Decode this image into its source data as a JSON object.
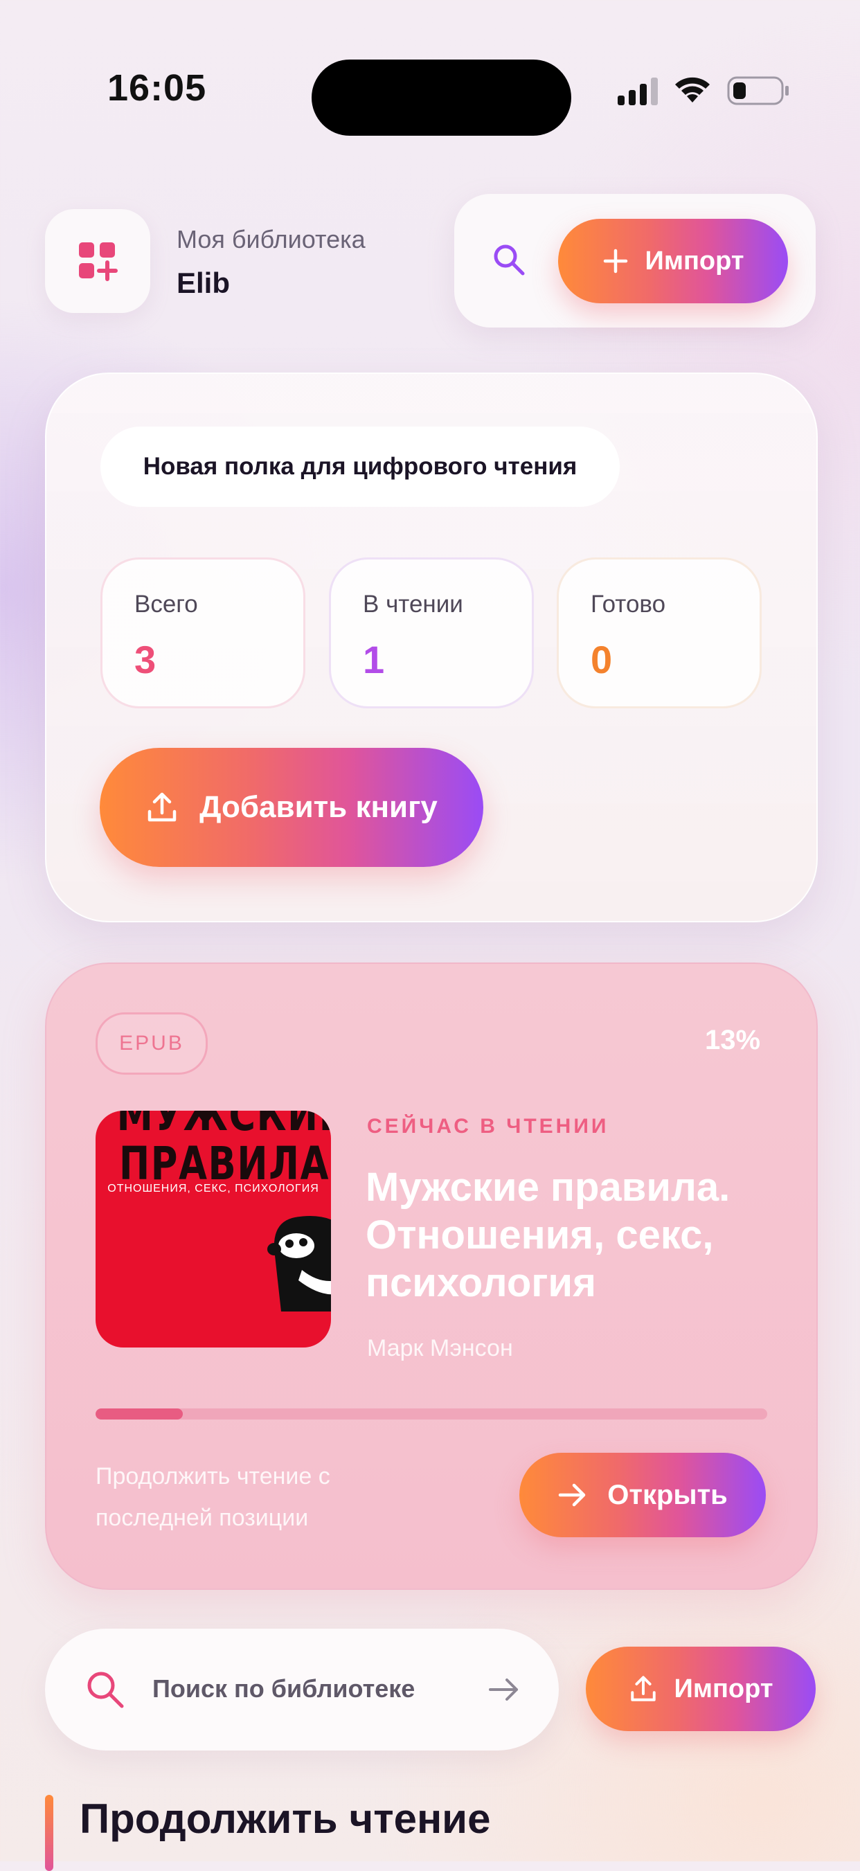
{
  "status_bar": {
    "time": "16:05"
  },
  "header": {
    "subtitle": "Моя библиотека",
    "title": "Elib",
    "import_label": "Импорт"
  },
  "shelf": {
    "label": "Новая полка для цифрового чтения",
    "stats": [
      {
        "label": "Всего",
        "value": "3",
        "color": "#ee4f78"
      },
      {
        "label": "В чтении",
        "value": "1",
        "color": "#b24ce8"
      },
      {
        "label": "Готово",
        "value": "0",
        "color": "#f4822d"
      }
    ],
    "add_button_label": "Добавить книгу"
  },
  "reading": {
    "format_badge": "EPUB",
    "progress_text": "13%",
    "progress": 0.13,
    "now_label": "СЕЙЧАС В ЧТЕНИИ",
    "book_title": "Мужские правила. Отношения, секс, психология",
    "author": "Марк  Мэнсон",
    "cover": {
      "line1": "МУЖСКИЕ",
      "line2": "ПРАВИЛА",
      "line3": "ОТНОШЕНИЯ, СЕКС, ПСИХОЛОГИЯ"
    },
    "continue_text": "Продолжить чтение с последней позиции",
    "open_label": "Открыть"
  },
  "search": {
    "placeholder": "Поиск по библиотеке",
    "import_label": "Импорт"
  },
  "section": {
    "title": "Продолжить чтение"
  },
  "colors": {
    "accent_gradient": [
      "#ff8a3a",
      "#e0559a",
      "#9a4cf5"
    ],
    "pink": "#ee4f78",
    "purple": "#b24ce8",
    "orange": "#f4822d"
  }
}
